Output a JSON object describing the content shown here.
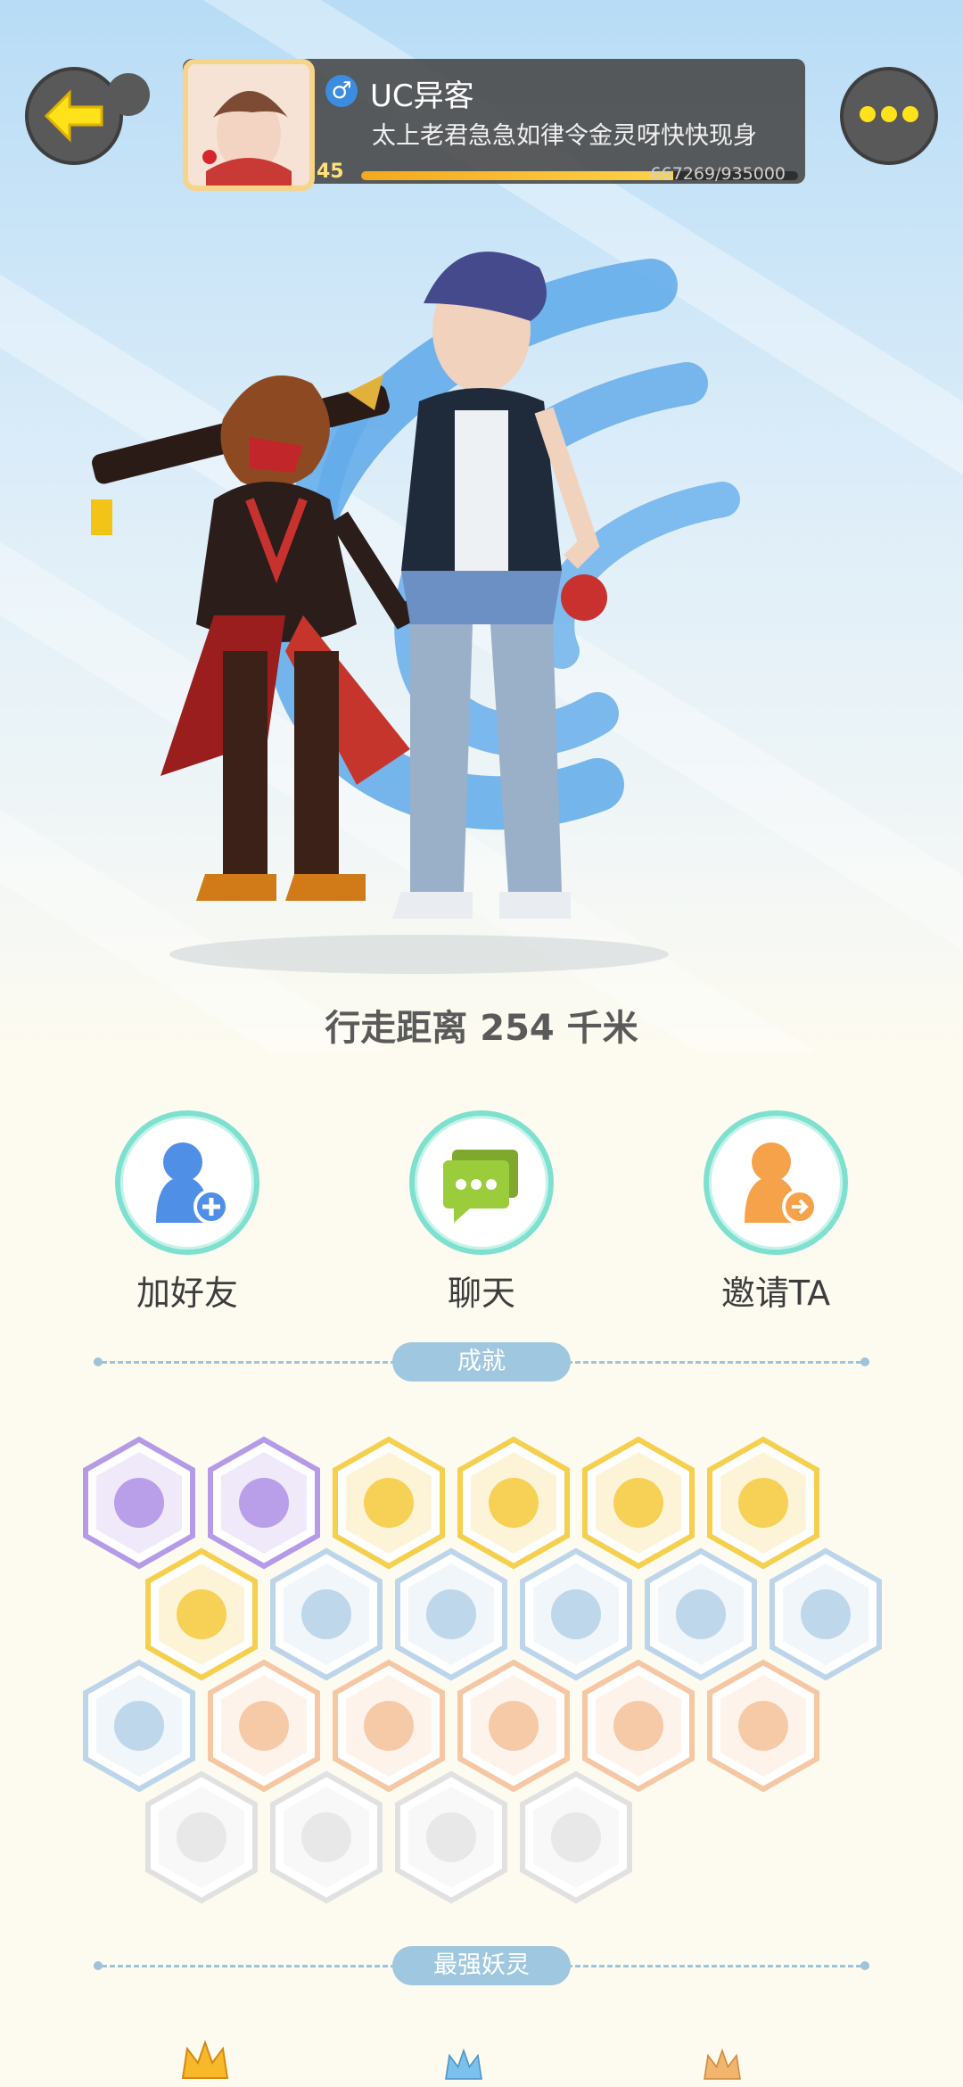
{
  "profile": {
    "nickname": "UC异客",
    "gender_symbol": "♂",
    "signature": "太上老君急急如律令金灵呀快快现身",
    "level": "45",
    "exp_text": "667269/935000",
    "exp_current": 667269,
    "exp_total": 935000
  },
  "distance_text": "行走距离 254 千米",
  "actions": [
    {
      "label": "加好友",
      "icon": "add-friend-icon",
      "color": "#4f8fe6"
    },
    {
      "label": "聊天",
      "icon": "chat-icon",
      "color": "#9bcc3c"
    },
    {
      "label": "邀请TA",
      "icon": "invite-icon",
      "color": "#f5a24a"
    }
  ],
  "sections": {
    "achievements": "成就",
    "strongest": "最强妖灵"
  },
  "achievements": [
    {
      "icon": "devil-icon",
      "theme": "purple"
    },
    {
      "icon": "crystal-ball-icon",
      "theme": "purple"
    },
    {
      "icon": "sun-icon",
      "theme": "gold"
    },
    {
      "icon": "eclipse-icon",
      "theme": "gold"
    },
    {
      "icon": "flame-taiji-icon",
      "theme": "gold"
    },
    {
      "icon": "taiji-box-icon",
      "theme": "gold"
    },
    {
      "icon": "fox-book-icon",
      "theme": "gold"
    },
    {
      "icon": "sneaker-icon",
      "theme": "blue"
    },
    {
      "icon": "crystal-icon",
      "theme": "blue"
    },
    {
      "icon": "spirit-statue-icon",
      "theme": "blue"
    },
    {
      "icon": "gong-icon",
      "theme": "blue"
    },
    {
      "icon": "beast-statue-icon",
      "theme": "blue"
    },
    {
      "icon": "no1-icon",
      "theme": "blue"
    },
    {
      "icon": "cart-icon",
      "theme": "orange"
    },
    {
      "icon": "cat-spirit-icon",
      "theme": "orange"
    },
    {
      "icon": "fish-spirit-icon",
      "theme": "orange"
    },
    {
      "icon": "fox-spirit-icon",
      "theme": "orange"
    },
    {
      "icon": "angry-sack-icon",
      "theme": "orange"
    },
    {
      "icon": "belt-icon",
      "theme": "gray"
    },
    {
      "icon": "crossed-swords-icon",
      "theme": "gray"
    },
    {
      "icon": "duo-spirits-icon",
      "theme": "gray"
    },
    {
      "icon": "scroll-pet-icon",
      "theme": "gray"
    }
  ],
  "colors": {
    "purple": "#b59ae8",
    "gold": "#f5cf4e",
    "blue": "#bcd5ea",
    "orange": "#f5c7a3",
    "gray": "#e1e1e1"
  }
}
